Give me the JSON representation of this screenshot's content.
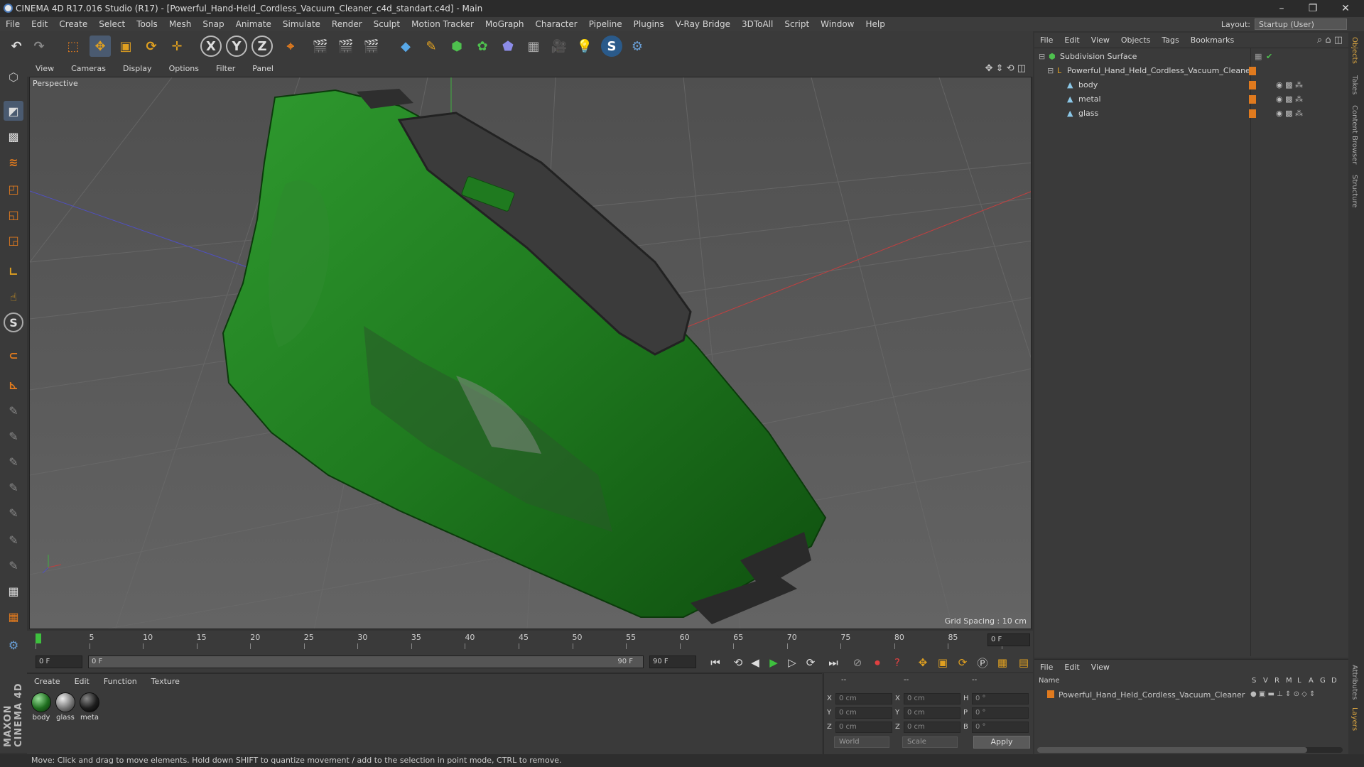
{
  "window": {
    "title": "CINEMA 4D R17.016 Studio (R17) - [Powerful_Hand-Held_Cordless_Vacuum_Cleaner_c4d_standart.c4d] - Main",
    "controls": [
      "–",
      "❐",
      "✕"
    ]
  },
  "menubar": {
    "items": [
      "File",
      "Edit",
      "Create",
      "Select",
      "Tools",
      "Mesh",
      "Snap",
      "Animate",
      "Simulate",
      "Render",
      "Sculpt",
      "Motion Tracker",
      "MoGraph",
      "Character",
      "Pipeline",
      "Plugins",
      "V-Ray Bridge",
      "3DToAll",
      "Script",
      "Window",
      "Help"
    ],
    "layout_label": "Layout:",
    "layout_value": "Startup (User)"
  },
  "toolbar": {
    "axes": [
      "X",
      "Y",
      "Z"
    ]
  },
  "viewport": {
    "menu": [
      "View",
      "Cameras",
      "Display",
      "Options",
      "Filter",
      "Panel"
    ],
    "label": "Perspective",
    "grid_spacing": "Grid Spacing : 10 cm"
  },
  "timeline": {
    "ticks": [
      "0",
      "5",
      "10",
      "15",
      "20",
      "25",
      "30",
      "35",
      "40",
      "45",
      "50",
      "55",
      "60",
      "65",
      "70",
      "75",
      "80",
      "85",
      "90"
    ],
    "frame_end_label": "0 F",
    "progress": 0
  },
  "transport": {
    "start": "0 F",
    "slider_start": "0 F",
    "slider_end": "90 F",
    "end": "90 F"
  },
  "materials": {
    "menu": [
      "Create",
      "Edit",
      "Function",
      "Texture"
    ],
    "items": [
      {
        "name": "body",
        "color": "#1f6e1f"
      },
      {
        "name": "glass",
        "color": "#777777"
      },
      {
        "name": "meta",
        "color": "#1e1e1e"
      }
    ]
  },
  "coords": {
    "rows": [
      {
        "a": "X",
        "av": "0 cm",
        "b": "X",
        "bv": "0 cm",
        "c": "H",
        "cv": "0 °"
      },
      {
        "a": "Y",
        "av": "0 cm",
        "b": "Y",
        "bv": "0 cm",
        "c": "P",
        "cv": "0 °"
      },
      {
        "a": "Z",
        "av": "0 cm",
        "b": "Z",
        "bv": "0 cm",
        "c": "B",
        "cv": "0 °"
      }
    ],
    "headers": [
      "--",
      "--",
      "--"
    ],
    "mode": "World",
    "type": "Scale",
    "apply": "Apply"
  },
  "objects": {
    "menu": [
      "File",
      "Edit",
      "View",
      "Objects",
      "Tags",
      "Bookmarks"
    ],
    "tree": [
      {
        "name": "Subdivision Surface",
        "indent": 0
      },
      {
        "name": "Powerful_Hand_Held_Cordless_Vacuum_Cleaner",
        "indent": 1
      },
      {
        "name": "body",
        "indent": 2
      },
      {
        "name": "metal",
        "indent": 2
      },
      {
        "name": "glass",
        "indent": 2
      }
    ]
  },
  "layers": {
    "menu": [
      "File",
      "Edit",
      "View"
    ],
    "columns": [
      "Name",
      "S",
      "V",
      "R",
      "M",
      "L",
      "A",
      "G",
      "D"
    ],
    "row": "Powerful_Hand_Held_Cordless_Vacuum_Cleaner"
  },
  "right_tabs": [
    "Objects",
    "Takes",
    "Content Browser",
    "Structure",
    "Attributes",
    "Layers"
  ],
  "status": "Move: Click and drag to move elements. Hold down SHIFT to quantize movement / add to the selection in point mode, CTRL to remove.",
  "brand": "MAXON CINEMA 4D"
}
